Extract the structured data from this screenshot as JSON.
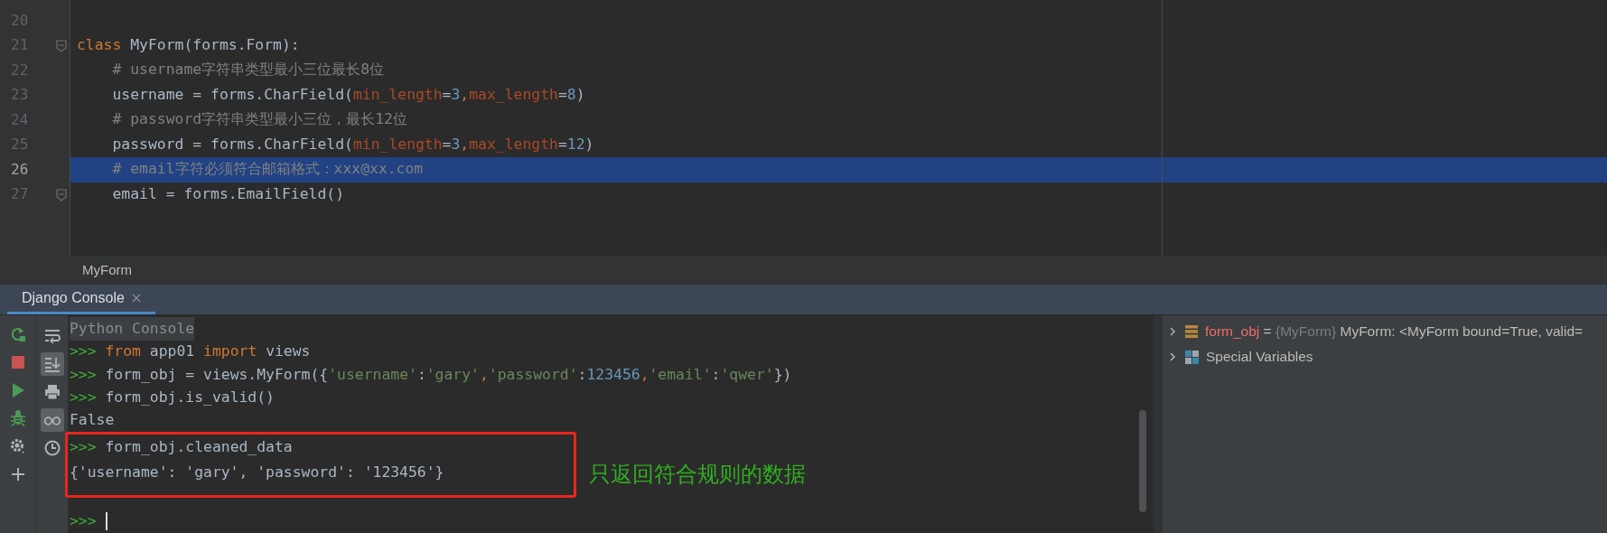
{
  "editor": {
    "lines": [
      {
        "number": "20",
        "selected": false,
        "fold": false
      },
      {
        "number": "21",
        "selected": false,
        "fold": true,
        "tokens": [
          {
            "kind": "keyword",
            "text": "class "
          },
          {
            "kind": "plain",
            "text": "MyForm(forms.Form):"
          }
        ]
      },
      {
        "number": "22",
        "selected": false,
        "fold": false,
        "tokens": [
          {
            "kind": "comment",
            "text": "    # username字符串类型最小三位最长8位"
          }
        ]
      },
      {
        "number": "23",
        "selected": false,
        "fold": false,
        "tokens": [
          {
            "kind": "plain",
            "text": "    username = forms.CharField("
          },
          {
            "kind": "param",
            "text": "min_length"
          },
          {
            "kind": "plain",
            "text": "="
          },
          {
            "kind": "number",
            "text": "3"
          },
          {
            "kind": "punct",
            "text": ","
          },
          {
            "kind": "param",
            "text": "max_length"
          },
          {
            "kind": "plain",
            "text": "="
          },
          {
            "kind": "number",
            "text": "8"
          },
          {
            "kind": "plain",
            "text": ")"
          }
        ]
      },
      {
        "number": "24",
        "selected": false,
        "fold": false,
        "tokens": [
          {
            "kind": "comment",
            "text": "    # password字符串类型最小三位，最长12位"
          }
        ]
      },
      {
        "number": "25",
        "selected": false,
        "fold": false,
        "tokens": [
          {
            "kind": "plain",
            "text": "    password = forms.CharField("
          },
          {
            "kind": "param",
            "text": "min_length"
          },
          {
            "kind": "plain",
            "text": "="
          },
          {
            "kind": "number",
            "text": "3"
          },
          {
            "kind": "punct",
            "text": ","
          },
          {
            "kind": "param",
            "text": "max_length"
          },
          {
            "kind": "plain",
            "text": "="
          },
          {
            "kind": "number",
            "text": "12"
          },
          {
            "kind": "plain",
            "text": ")"
          }
        ]
      },
      {
        "number": "26",
        "selected": true,
        "fold": false,
        "tokens": [
          {
            "kind": "comment",
            "text": "    # email字符必须符合邮箱格式：xxx@xx.com"
          }
        ]
      },
      {
        "number": "27",
        "selected": false,
        "fold": true,
        "tokens": [
          {
            "kind": "plain",
            "text": "    email = forms.EmailField()"
          }
        ]
      }
    ]
  },
  "breadcrumb": "MyForm",
  "tabs": [
    {
      "label": "Django Console",
      "selected": true
    }
  ],
  "toolbar": [
    {
      "kind": "rerun"
    },
    {
      "kind": "stop"
    },
    {
      "kind": "run"
    },
    {
      "kind": "debug"
    },
    {
      "kind": "settings"
    },
    {
      "kind": "add"
    }
  ],
  "toolbar_toggles": [
    {
      "kind": "wrap",
      "on": false
    },
    {
      "kind": "scroll-end",
      "on": true
    },
    {
      "kind": "print",
      "on": false
    },
    {
      "kind": "glasses",
      "on": true
    },
    {
      "kind": "history",
      "on": false
    }
  ],
  "console": {
    "lines": [
      {
        "kind": "banner",
        "boxed": false,
        "text": "Python Console"
      },
      {
        "kind": "code",
        "boxed": false,
        "tokens": [
          {
            "kind": "prompt",
            "text": ">>> "
          },
          {
            "kind": "keyword",
            "text": "from"
          },
          {
            "kind": "plain",
            "text": " app01 "
          },
          {
            "kind": "keyword",
            "text": "import"
          },
          {
            "kind": "plain",
            "text": " views"
          }
        ]
      },
      {
        "kind": "code",
        "boxed": false,
        "tokens": [
          {
            "kind": "prompt",
            "text": ">>> "
          },
          {
            "kind": "plain",
            "text": "form_obj = views.MyForm({"
          },
          {
            "kind": "string",
            "text": "'username'"
          },
          {
            "kind": "plain",
            "text": ":"
          },
          {
            "kind": "string",
            "text": "'gary'"
          },
          {
            "kind": "punct",
            "text": ","
          },
          {
            "kind": "string",
            "text": "'password'"
          },
          {
            "kind": "plain",
            "text": ":"
          },
          {
            "kind": "number",
            "text": "123456"
          },
          {
            "kind": "punct",
            "text": ","
          },
          {
            "kind": "string",
            "text": "'email'"
          },
          {
            "kind": "plain",
            "text": ":"
          },
          {
            "kind": "string",
            "text": "'qwer'"
          },
          {
            "kind": "plain",
            "text": "})"
          }
        ]
      },
      {
        "kind": "code",
        "boxed": false,
        "tokens": [
          {
            "kind": "prompt",
            "text": ">>> "
          },
          {
            "kind": "plain",
            "text": "form_obj.is_valid()"
          }
        ]
      },
      {
        "kind": "code",
        "boxed": false,
        "tokens": [
          {
            "kind": "plain",
            "text": "False"
          }
        ]
      },
      {
        "kind": "code",
        "boxed": true,
        "tokens": [
          {
            "kind": "prompt",
            "text": ">>> "
          },
          {
            "kind": "plain",
            "text": "form_obj.cleaned_data"
          }
        ]
      },
      {
        "kind": "code",
        "boxed": true,
        "tokens": [
          {
            "kind": "plain",
            "text": "{'username': 'gary', 'password': '123456'}"
          }
        ]
      },
      {
        "kind": "input",
        "boxed": false,
        "tokens": [
          {
            "kind": "prompt",
            "text": ">>>"
          }
        ]
      }
    ],
    "annotation": "只返回符合规则的数据"
  },
  "variables": [
    {
      "kind": "variable",
      "expanded": false,
      "name": "form_obj",
      "separator": "=",
      "type": "{MyForm}",
      "value": "MyForm: <MyForm bound=True, valid="
    },
    {
      "kind": "group",
      "expanded": false,
      "name": "Special Variables"
    }
  ]
}
